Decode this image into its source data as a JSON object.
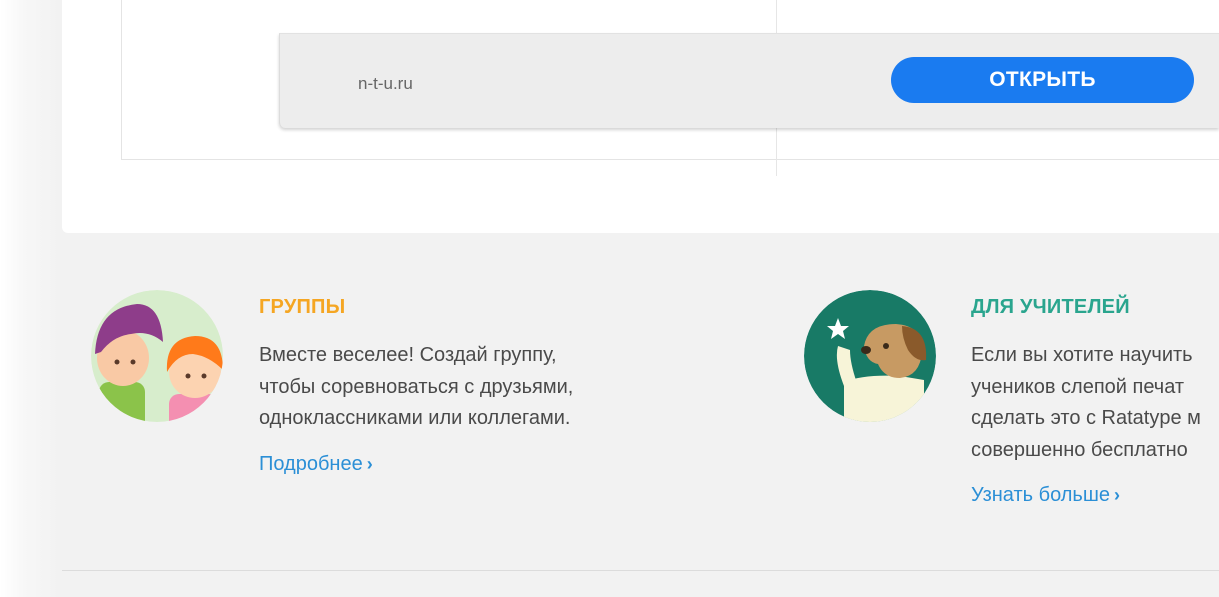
{
  "site_card": {
    "url": "n-t-u.ru",
    "open_label": "ОТКРЫТЬ"
  },
  "features": {
    "groups": {
      "title": "ГРУППЫ",
      "lines": [
        "Вместе веселее! Создай группу,",
        "чтобы соревноваться с друзьями,",
        "одноклассниками или коллегами."
      ],
      "link_label": "Подробнее",
      "chevron": "›",
      "icon": "kids-illustration-icon"
    },
    "teachers": {
      "title": "ДЛЯ УЧИТЕЛЕЙ",
      "lines": [
        "Если вы хотите научить",
        "учеников слепой печат",
        "сделать это с Ratatype м",
        "совершенно бесплатно"
      ],
      "link_label": "Узнать больше",
      "chevron": "›",
      "icon": "dog-teacher-illustration-icon"
    }
  },
  "colors": {
    "accent_blue": "#1a7bf0",
    "groups_title": "#f5a623",
    "teachers_title": "#2aa58e",
    "link": "#2b8fd6"
  }
}
